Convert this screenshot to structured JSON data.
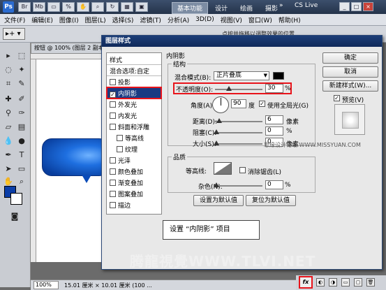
{
  "app": {
    "logo": "Ps",
    "workspace_tabs": [
      "基本功能",
      "设计",
      "绘画",
      "摄影"
    ],
    "more": "»",
    "cs_live": "CS Live",
    "window_controls": [
      "_",
      "□",
      "×"
    ]
  },
  "menu": [
    "文件(F)",
    "编辑(E)",
    "图像(I)",
    "图层(L)",
    "选择(S)",
    "滤镜(T)",
    "分析(A)",
    "3D(D)",
    "视图(V)",
    "窗口(W)",
    "帮助(H)"
  ],
  "options": {
    "tool_label": "▸+ ▾",
    "hint": "点按并拖移以调整效果的位置"
  },
  "document": {
    "tab": "按钮 @ 100% (图层 2 副本",
    "zoom": "100%",
    "size": "15.01 厘米 × 10.01 厘米 (100 ..."
  },
  "dialog": {
    "title": "图层样式",
    "style_header": "样式",
    "blend_options": "混合选项:自定",
    "styles": [
      {
        "label": "投影",
        "checked": false,
        "sub": false
      },
      {
        "label": "内阴影",
        "checked": true,
        "sub": false,
        "selected": true
      },
      {
        "label": "外发光",
        "checked": false,
        "sub": false
      },
      {
        "label": "内发光",
        "checked": false,
        "sub": false
      },
      {
        "label": "斜面和浮雕",
        "checked": false,
        "sub": false
      },
      {
        "label": "等高线",
        "checked": false,
        "sub": true
      },
      {
        "label": "纹理",
        "checked": false,
        "sub": true
      },
      {
        "label": "光泽",
        "checked": false,
        "sub": false
      },
      {
        "label": "颜色叠加",
        "checked": false,
        "sub": false
      },
      {
        "label": "渐变叠加",
        "checked": false,
        "sub": false
      },
      {
        "label": "图案叠加",
        "checked": false,
        "sub": false
      },
      {
        "label": "描边",
        "checked": false,
        "sub": false
      }
    ],
    "section_title": "内阴影",
    "structure_title": "结构",
    "blend_mode_label": "混合模式(B):",
    "blend_mode_value": "正片叠底",
    "opacity_label": "不透明度(O):",
    "opacity_value": "30",
    "percent": "%",
    "angle_label": "角度(A):",
    "angle_value": "90",
    "degree": "度",
    "global_light_label": "使用全局光(G)",
    "global_light_checked": true,
    "distance_label": "距离(D):",
    "distance_value": "6",
    "choke_label": "阻塞(C):",
    "choke_value": "0",
    "size_label": "大小(S):",
    "size_value": "0",
    "px": "像素",
    "quality_title": "品质",
    "contour_label": "等高线:",
    "antialias_label": "消除锯齿(L)",
    "noise_label": "杂色(N):",
    "noise_value": "0",
    "set_default": "设置为默认值",
    "reset_default": "复位为默认值",
    "ok": "确定",
    "cancel": "取消",
    "new_style": "新建样式(W)...",
    "preview_label": "预览(V)",
    "preview_checked": true,
    "checkmark": "✓"
  },
  "caption": "设置 “内阴影” 项目",
  "watermarks": {
    "site": "思缘设计论坛 WWW.MISSYUAN.COM",
    "bottom": "腾龍視覺WWW.TLVI.NET"
  },
  "layers_bottom": {
    "fx": "fx"
  },
  "colors": {
    "foreground": "#0b3ea8",
    "background": "#ffffff",
    "highlight": "#e8141b"
  }
}
